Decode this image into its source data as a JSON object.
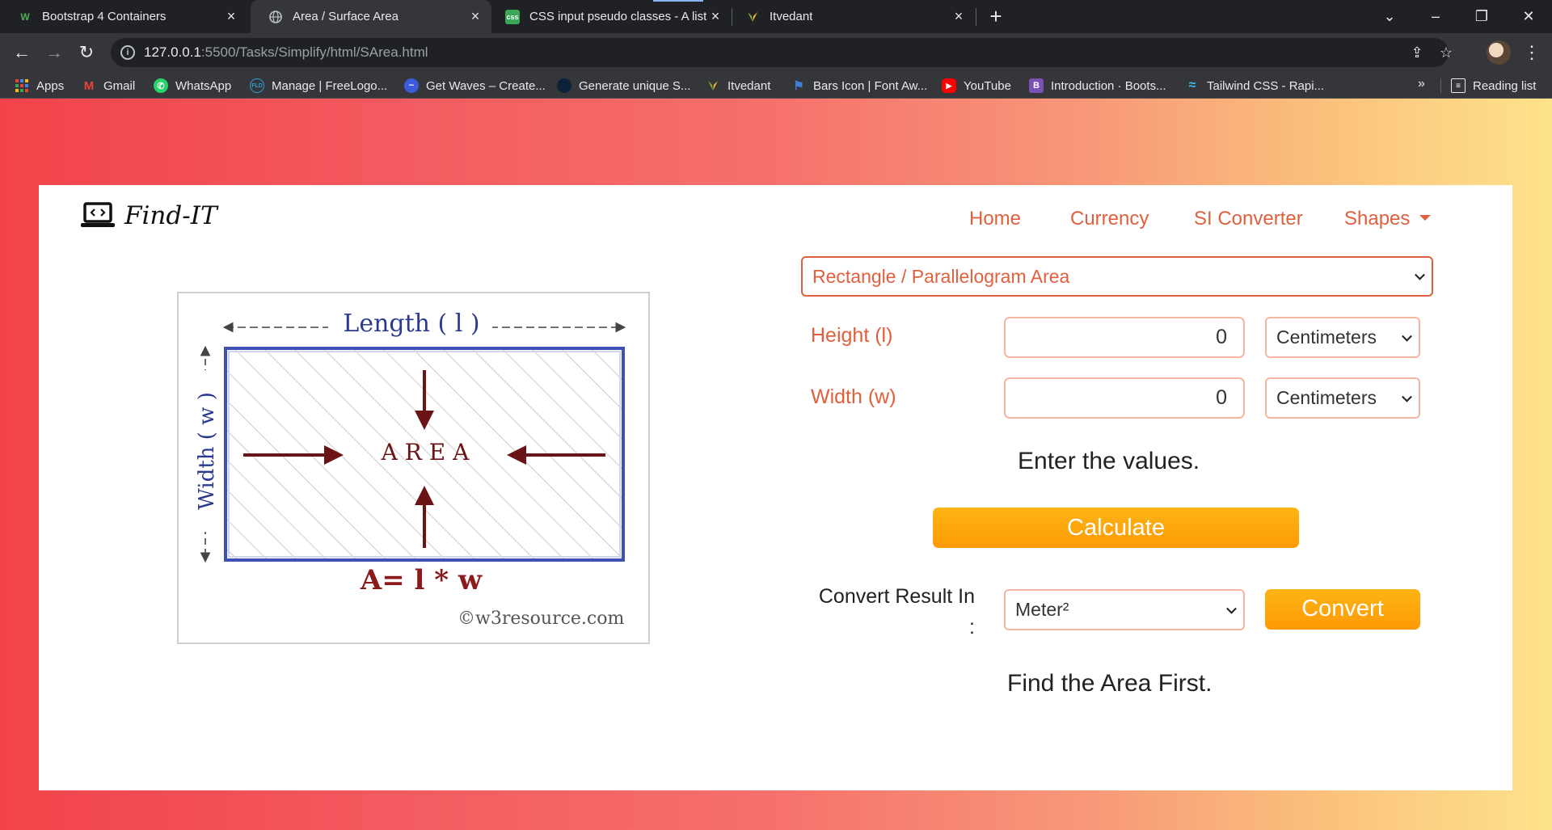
{
  "browser": {
    "tabs": [
      {
        "title": "Bootstrap 4 Containers",
        "icon": "w3schools-icon"
      },
      {
        "title": "Area / Surface Area",
        "icon": "globe-icon",
        "active": true
      },
      {
        "title": "CSS input pseudo classes - A list",
        "icon": "css-file-icon"
      },
      {
        "title": "Itvedant",
        "icon": "itvedant-icon"
      }
    ],
    "address": {
      "host": "127.0.0.1",
      "path": ":5500/Tasks/Simplify/html/SArea.html"
    },
    "bookmarks": [
      {
        "label": "Apps",
        "icon": "apps-grid-icon",
        "color": "#ea4335"
      },
      {
        "label": "Gmail",
        "icon": "gmail-icon",
        "color": "#ea4335"
      },
      {
        "label": "WhatsApp",
        "icon": "whatsapp-icon",
        "color": "#25d366"
      },
      {
        "label": "Manage | FreeLogo...",
        "icon": "freelogo-icon",
        "color": "#2a9fd6"
      },
      {
        "label": "Get Waves – Create...",
        "icon": "waves-icon",
        "color": "#3b5bdb"
      },
      {
        "label": "Generate unique S...",
        "icon": "circle-icon",
        "color": "#0b2239"
      },
      {
        "label": "Itvedant",
        "icon": "itvedant-icon",
        "color": "#8bc34a"
      },
      {
        "label": "Bars Icon | Font Aw...",
        "icon": "flag-icon",
        "color": "#3f7fd6"
      },
      {
        "label": "YouTube",
        "icon": "youtube-icon",
        "color": "#ff0000"
      },
      {
        "label": "Introduction · Boots...",
        "icon": "bootstrap-icon",
        "color": "#7952b3"
      },
      {
        "label": "Tailwind CSS - Rapi...",
        "icon": "tailwind-icon",
        "color": "#38bdf8"
      }
    ],
    "reading_list": "Reading list",
    "more": "»"
  },
  "page": {
    "brand": "Find-IT",
    "nav": [
      "Home",
      "Currency",
      "SI Converter",
      "Shapes"
    ],
    "shape_select": "Rectangle / Parallelogram Area",
    "fields": [
      {
        "label": "Height (l)",
        "value": "0",
        "unit": "Centimeters"
      },
      {
        "label": "Width (w)",
        "value": "0",
        "unit": "Centimeters"
      }
    ],
    "message": "Enter the values.",
    "calculate": "Calculate",
    "convert_label": "Convert Result In :",
    "convert_unit": "Meter²",
    "convert": "Convert",
    "result": "Find the Area First."
  },
  "diagram": {
    "length_label": "Length ( l )",
    "width_label": "Width ( w )",
    "area_label": "A R E A",
    "formula": "A= l * w",
    "credit": "©w3resource.com"
  },
  "colors": {
    "accent": "#e0603d",
    "button": "#fda50f",
    "diagram_border": "#3f51b5",
    "arrow": "#6b1416"
  }
}
